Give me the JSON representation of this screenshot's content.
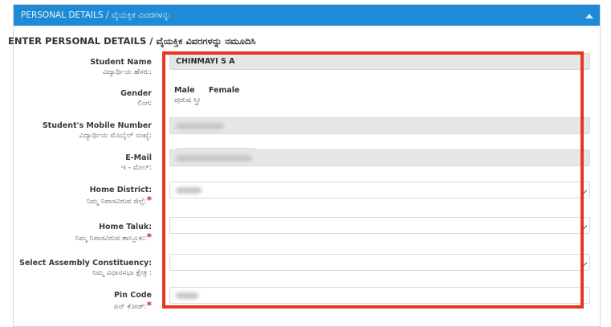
{
  "panel": {
    "header": "PERSONAL DETAILS / ವೈಯಕ್ತಿಕ ವಿವರಗಳನ್ನು",
    "section_title": "ENTER PERSONAL DETAILS / ವೈಯಕ್ತಿಕ ವಿವರಗಳನ್ನು ನಮೂದಿಸಿ"
  },
  "fields": {
    "student_name": {
      "label": "Student Name",
      "label_kn": "ವಿದ್ಯಾರ್ಥಿಯ ಹೆಸರು:",
      "value": "CHINMAYI S A"
    },
    "gender": {
      "label": "Gender",
      "label_kn": "ಲಿಂಗ:",
      "options": [
        "Male",
        "Female"
      ],
      "options_kn": "ಪುರುಷ ಸ್ತ್ರೀ"
    },
    "mobile": {
      "label": "Student's Mobile Number",
      "label_kn": "ವಿದ್ಯಾರ್ಥಿಯ ಮೊಬೈಲ್ ಸಂಖ್ಯೆ:"
    },
    "email": {
      "label": "E-Mail",
      "label_kn": "ಇ - ಮೇಲ್:"
    },
    "home_district": {
      "label": "Home District:",
      "label_kn": "ನಿಮ್ಮ ನಿವಾಸವಿರುವ ಜಿಲ್ಲೆ:"
    },
    "home_taluk": {
      "label": "Home Taluk:",
      "label_kn": "ನಿಮ್ಮ ನಿವಾಸವಿರುವ ತಾಲ್ಲೂಕು:"
    },
    "assembly": {
      "label": "Select Assembly Constituency:",
      "label_kn": "ನಿಮ್ಮ ವಿಧಾನಸಭಾ ಕ್ಷೇತ್ರ :"
    },
    "pin_code": {
      "label": "Pin Code",
      "label_kn": "ಪಿನ್ ಕೋಡ್:"
    }
  },
  "required_mark": "*",
  "colors": {
    "header": "#1f8ad6",
    "highlight": "#e8361f",
    "required": "#d21f1f"
  }
}
